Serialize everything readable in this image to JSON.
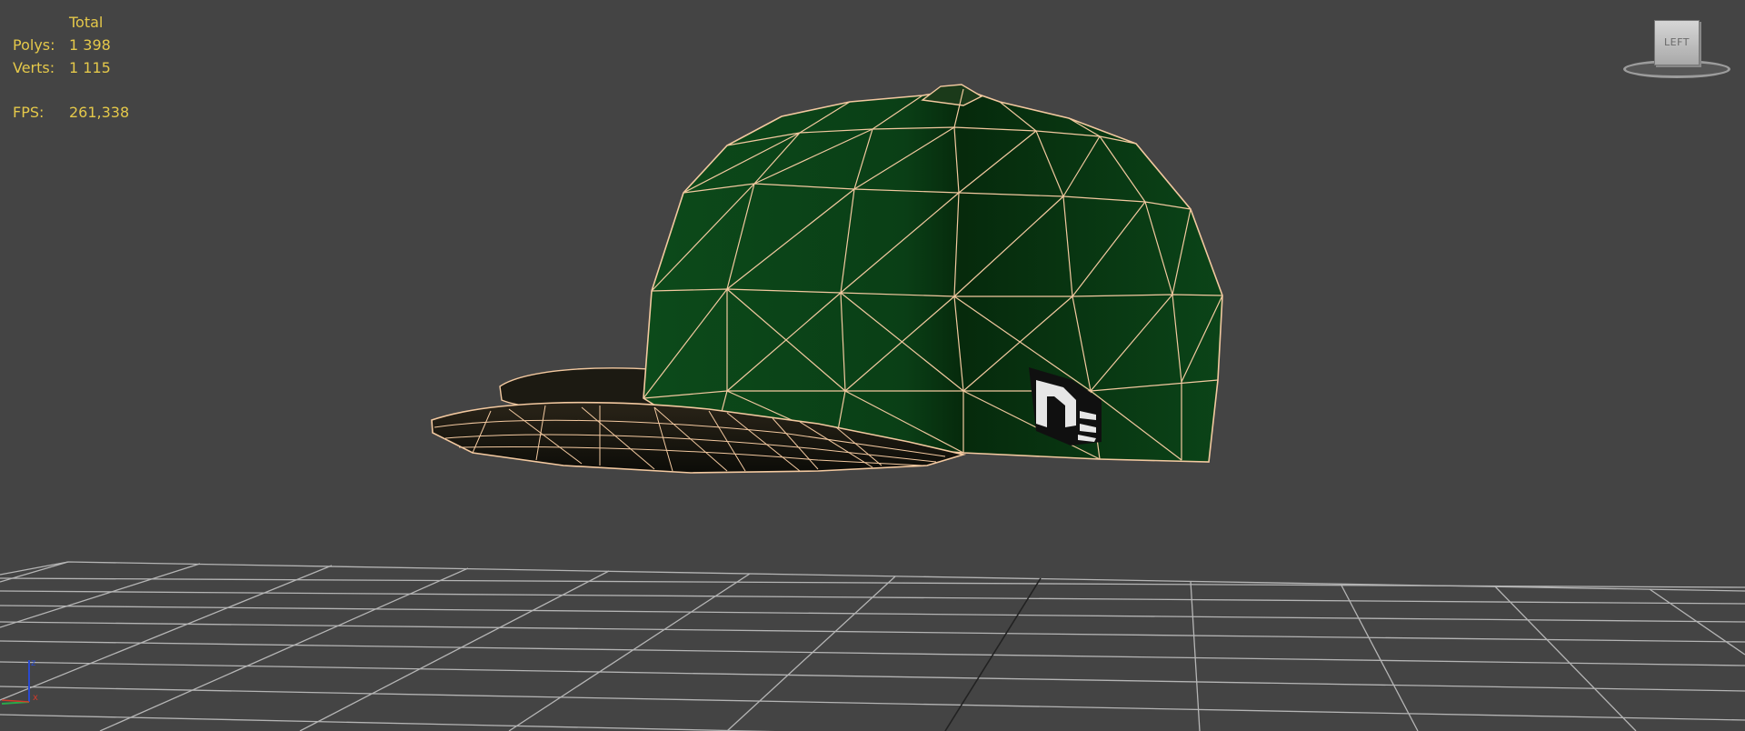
{
  "stats": {
    "header": "Total",
    "polys_label": "Polys:",
    "polys_value": "1 398",
    "verts_label": "Verts:",
    "verts_value": "1 115",
    "fps_label": "FPS:",
    "fps_value": "261,338"
  },
  "viewcube": {
    "face_label": "LEFT"
  },
  "axes": {
    "z_label": "z",
    "x_label": "x"
  },
  "colors": {
    "viewport_background": "#444444",
    "stats_text": "#e4c84a",
    "wireframe": "#f3c9a0",
    "cap_green": "#0b3a14",
    "grid_line": "#b0b0b0",
    "axis_x": "#d03a2a",
    "axis_y": "#2aa84a",
    "axis_z": "#2a4ad0"
  }
}
